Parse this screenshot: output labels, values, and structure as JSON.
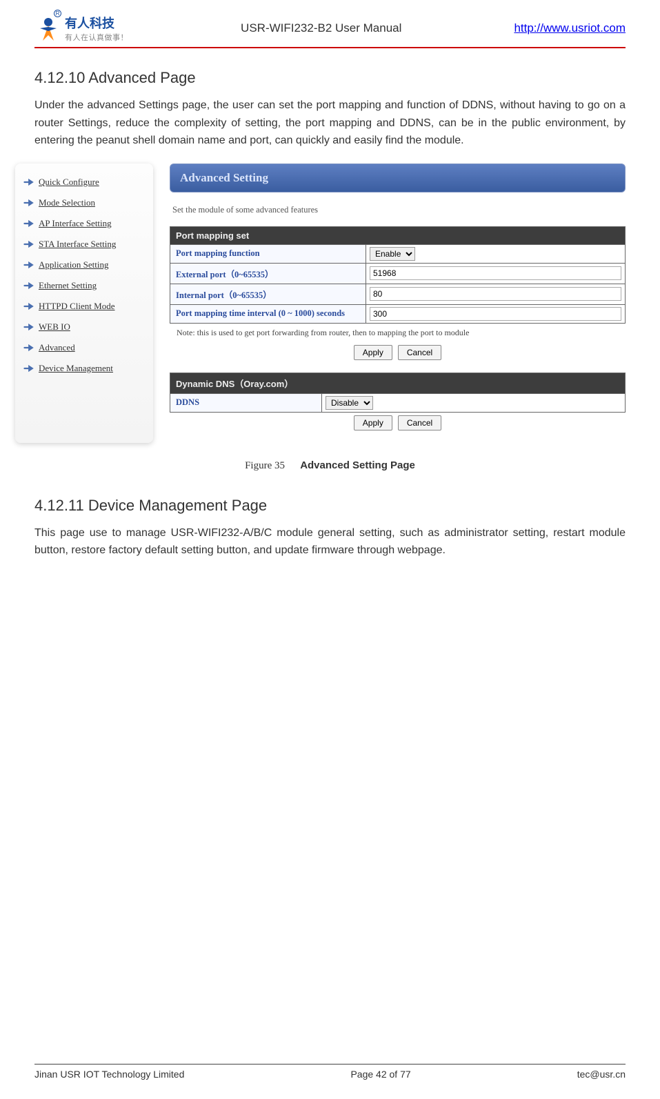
{
  "header": {
    "logo_cn": "有人科技",
    "logo_sub": "有人在认真做事！",
    "manual_title": "USR-WIFI232-B2 User Manual",
    "link": "http://www.usriot.com"
  },
  "section1": {
    "heading": "4.12.10    Advanced Page",
    "text": "Under the advanced Settings page, the user can set the port mapping and function of DDNS, without having to go on a router Settings, reduce the complexity of setting, the port mapping and DDNS, can be in the public environment, by entering the peanut shell domain name and port, can quickly and easily find the module."
  },
  "sidebar": {
    "items": [
      "Quick Configure",
      "Mode Selection",
      "AP Interface Setting",
      "STA Interface Setting",
      "Application Setting",
      "Ethernet Setting",
      "HTTPD Client Mode",
      "WEB IO",
      "Advanced",
      "Device Management"
    ]
  },
  "panel": {
    "heading": "Advanced Setting",
    "desc": "Set the module of some advanced features",
    "portmap_title": "Port mapping set",
    "rows": [
      {
        "label": "Port mapping function",
        "value": "Enable",
        "type": "select"
      },
      {
        "label": "External port（0~65535）",
        "value": "51968",
        "type": "input"
      },
      {
        "label": "Internal port（0~65535）",
        "value": "80",
        "type": "input"
      },
      {
        "label": "Port mapping time interval (0 ~ 1000) seconds",
        "value": "300",
        "type": "input"
      }
    ],
    "note": "Note: this is used to get port forwarding from router, then to mapping the port to module",
    "apply": "Apply",
    "cancel": "Cancel",
    "ddns_title": "Dynamic DNS（Oray.com）",
    "ddns_label": "DDNS",
    "ddns_value": "Disable"
  },
  "figure": {
    "num": "Figure 35",
    "title": "Advanced Setting Page"
  },
  "section2": {
    "heading": "4.12.11    Device Management Page",
    "text": "This page use to manage USR-WIFI232-A/B/C module general setting, such as administrator setting, restart module button, restore factory default setting button, and update firmware through webpage."
  },
  "footer": {
    "left": "Jinan USR IOT Technology Limited",
    "center": "Page 42 of 77",
    "right": "tec@usr.cn"
  }
}
